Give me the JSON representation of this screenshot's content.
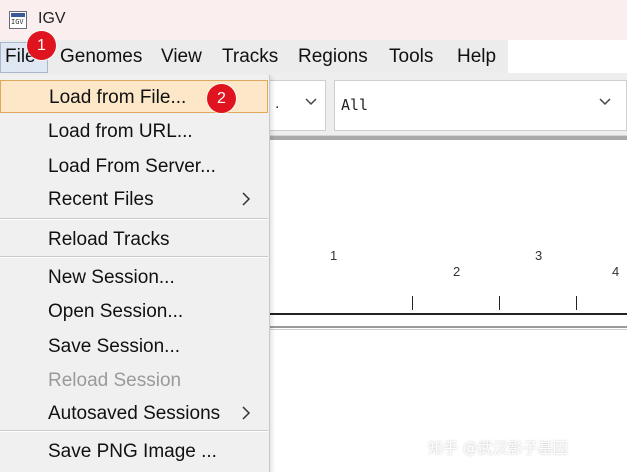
{
  "window": {
    "title": "IGV",
    "icon": "igv-app-icon",
    "icon_text": "IGV"
  },
  "menubar": {
    "items": [
      {
        "label": "File"
      },
      {
        "label": "Genomes"
      },
      {
        "label": "View"
      },
      {
        "label": "Tracks"
      },
      {
        "label": "Regions"
      },
      {
        "label": "Tools"
      },
      {
        "label": "Help"
      }
    ]
  },
  "toolbar": {
    "genome_combo_value": ".",
    "chromosome_combo_value": "All",
    "combo_icon": "chevron-down-icon"
  },
  "ruler": {
    "chromosome_labels": [
      "1",
      "2",
      "3",
      "4"
    ]
  },
  "file_menu": {
    "items": [
      {
        "label": "Load from File...",
        "highlighted": true
      },
      {
        "label": "Load from URL..."
      },
      {
        "label": "Load From Server..."
      },
      {
        "label": "Recent Files",
        "submenu": true
      },
      {
        "label": "Reload Tracks"
      },
      {
        "label": "New Session..."
      },
      {
        "label": "Open Session..."
      },
      {
        "label": "Save Session..."
      },
      {
        "label": "Reload Session",
        "disabled": true
      },
      {
        "label": "Autosaved Sessions",
        "submenu": true
      },
      {
        "label": "Save PNG Image ..."
      }
    ],
    "submenu_icon": "chevron-right-icon"
  },
  "annotations": {
    "step1": "1",
    "step2": "2",
    "badge_color": "#e0141e"
  },
  "watermark": {
    "text": "知乎 @武汉影子基因"
  }
}
